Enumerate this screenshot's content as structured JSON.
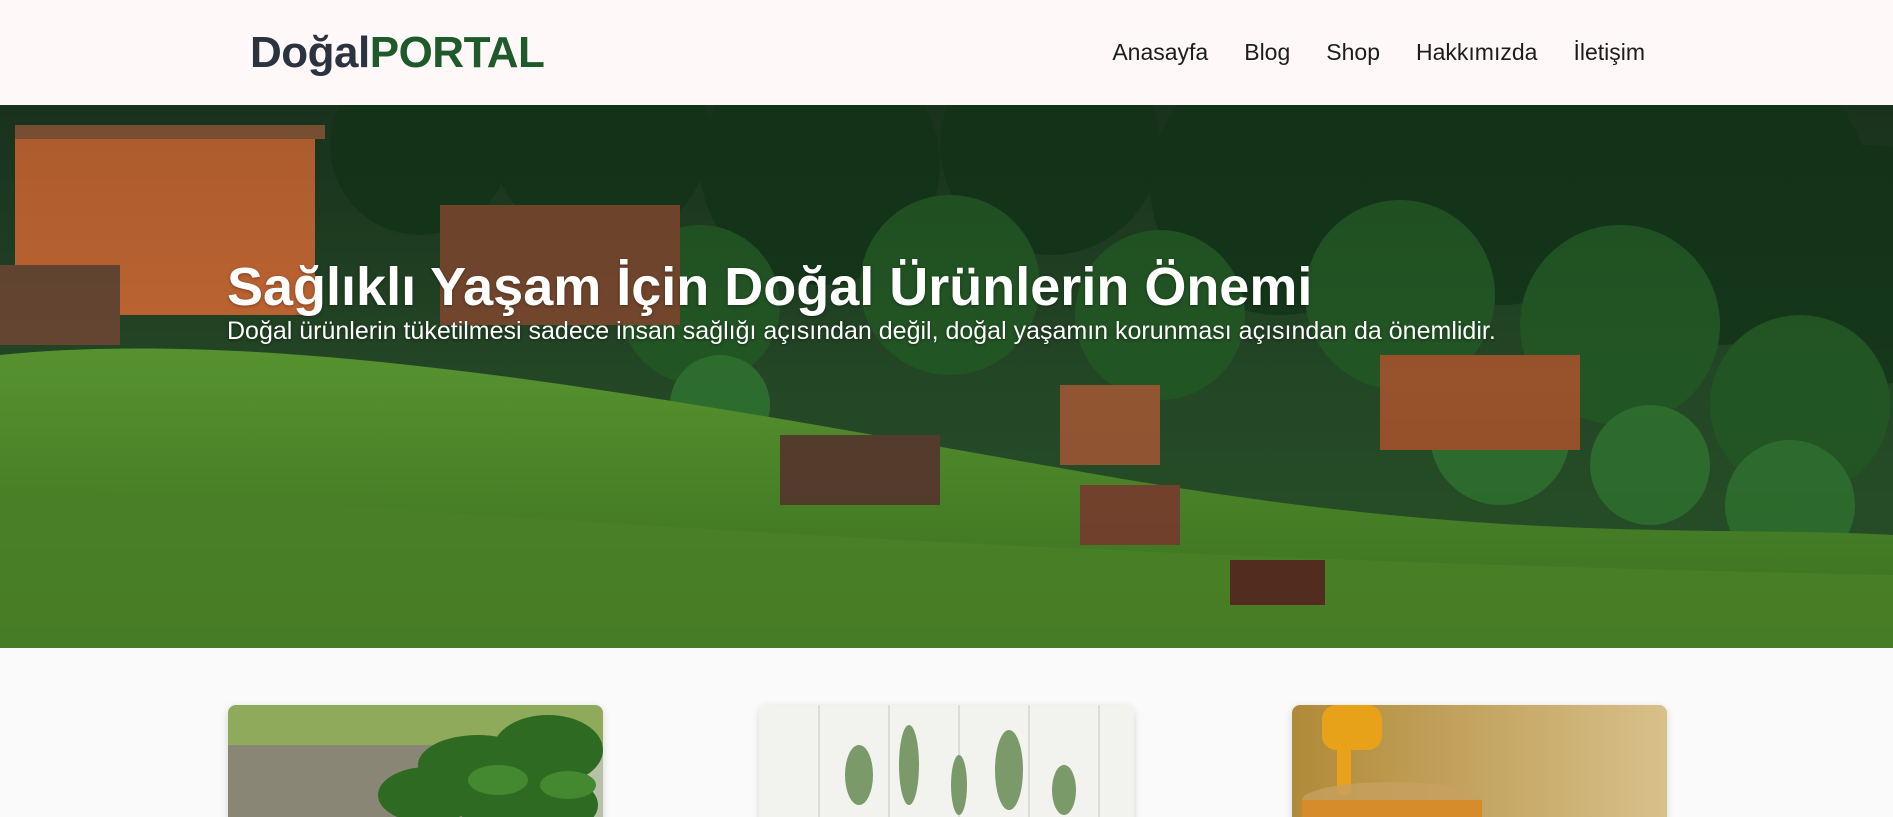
{
  "header": {
    "logo_part1": "Doğal",
    "logo_part2": "PORTAL",
    "nav": [
      "Anasayfa",
      "Blog",
      "Shop",
      "Hakkımızda",
      "İletişim"
    ]
  },
  "hero": {
    "title": "Sağlıklı Yaşam İçin Doğal Ürünlerin Önemi",
    "subtitle": "Doğal ürünlerin tüketilmesi sadece insan sağlığı açısından değil, doğal yaşamın korunması açısından da önemlidir."
  },
  "colors": {
    "logo_dark": "#2b3340",
    "logo_green": "#1f5a2a",
    "header_bg": "#fff8f8",
    "page_bg": "#fafafa"
  }
}
